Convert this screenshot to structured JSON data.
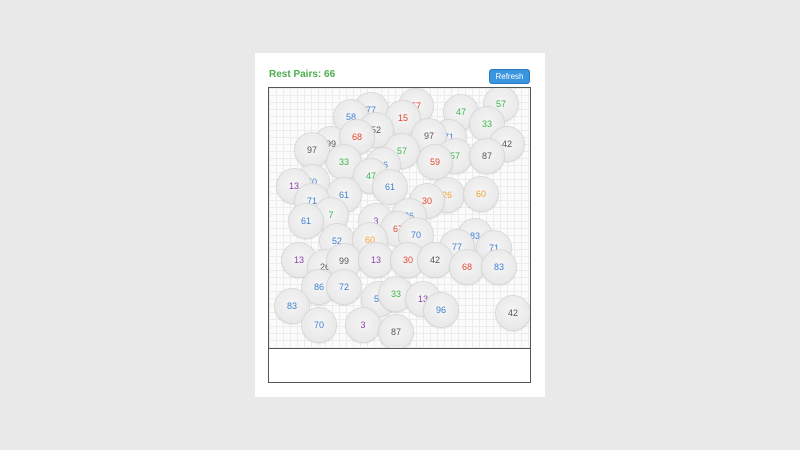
{
  "header": {
    "rest_pairs_text": "Rest Pairs: 66",
    "refresh_label": "Refresh"
  },
  "colors": {
    "blue": "#3d7fd0",
    "green": "#3bb54a",
    "red": "#e0452f",
    "orange": "#f0a030",
    "purple": "#8b3fae",
    "gray": "#555555",
    "teal": "#2aa58f"
  },
  "tiles": [
    {
      "label": "77",
      "color": "blue"
    },
    {
      "label": "57",
      "color": "red"
    },
    {
      "label": "47",
      "color": "green"
    },
    {
      "label": "57",
      "color": "green"
    },
    {
      "label": "58",
      "color": "blue"
    },
    {
      "label": "15",
      "color": "red"
    },
    {
      "label": "33",
      "color": "green"
    },
    {
      "label": "52",
      "color": "gray"
    },
    {
      "label": "99",
      "color": "gray"
    },
    {
      "label": "68",
      "color": "red"
    },
    {
      "label": "97",
      "color": "gray"
    },
    {
      "label": "71",
      "color": "blue"
    },
    {
      "label": "97",
      "color": "gray"
    },
    {
      "label": "42",
      "color": "gray"
    },
    {
      "label": "57",
      "color": "green"
    },
    {
      "label": "57",
      "color": "green"
    },
    {
      "label": "33",
      "color": "green"
    },
    {
      "label": "59",
      "color": "red"
    },
    {
      "label": "87",
      "color": "gray"
    },
    {
      "label": "86",
      "color": "blue"
    },
    {
      "label": "47",
      "color": "green"
    },
    {
      "label": "70",
      "color": "blue"
    },
    {
      "label": "13",
      "color": "purple"
    },
    {
      "label": "61",
      "color": "blue"
    },
    {
      "label": "61",
      "color": "blue"
    },
    {
      "label": "26",
      "color": "orange"
    },
    {
      "label": "60",
      "color": "orange"
    },
    {
      "label": "71",
      "color": "blue"
    },
    {
      "label": "30",
      "color": "red"
    },
    {
      "label": "7",
      "color": "green"
    },
    {
      "label": "61",
      "color": "blue"
    },
    {
      "label": "3",
      "color": "purple"
    },
    {
      "label": "86",
      "color": "blue"
    },
    {
      "label": "67",
      "color": "red"
    },
    {
      "label": "70",
      "color": "blue"
    },
    {
      "label": "83",
      "color": "blue"
    },
    {
      "label": "71",
      "color": "blue"
    },
    {
      "label": "52",
      "color": "blue"
    },
    {
      "label": "60",
      "color": "orange"
    },
    {
      "label": "77",
      "color": "blue"
    },
    {
      "label": "13",
      "color": "purple"
    },
    {
      "label": "26",
      "color": "gray"
    },
    {
      "label": "99",
      "color": "gray"
    },
    {
      "label": "13",
      "color": "purple"
    },
    {
      "label": "30",
      "color": "red"
    },
    {
      "label": "42",
      "color": "gray"
    },
    {
      "label": "68",
      "color": "red"
    },
    {
      "label": "83",
      "color": "blue"
    },
    {
      "label": "86",
      "color": "blue"
    },
    {
      "label": "72",
      "color": "blue"
    },
    {
      "label": "58",
      "color": "blue"
    },
    {
      "label": "33",
      "color": "green"
    },
    {
      "label": "13",
      "color": "purple"
    },
    {
      "label": "83",
      "color": "blue"
    },
    {
      "label": "96",
      "color": "blue"
    },
    {
      "label": "42",
      "color": "gray"
    },
    {
      "label": "70",
      "color": "blue"
    },
    {
      "label": "3",
      "color": "purple"
    },
    {
      "label": "87",
      "color": "gray"
    }
  ]
}
